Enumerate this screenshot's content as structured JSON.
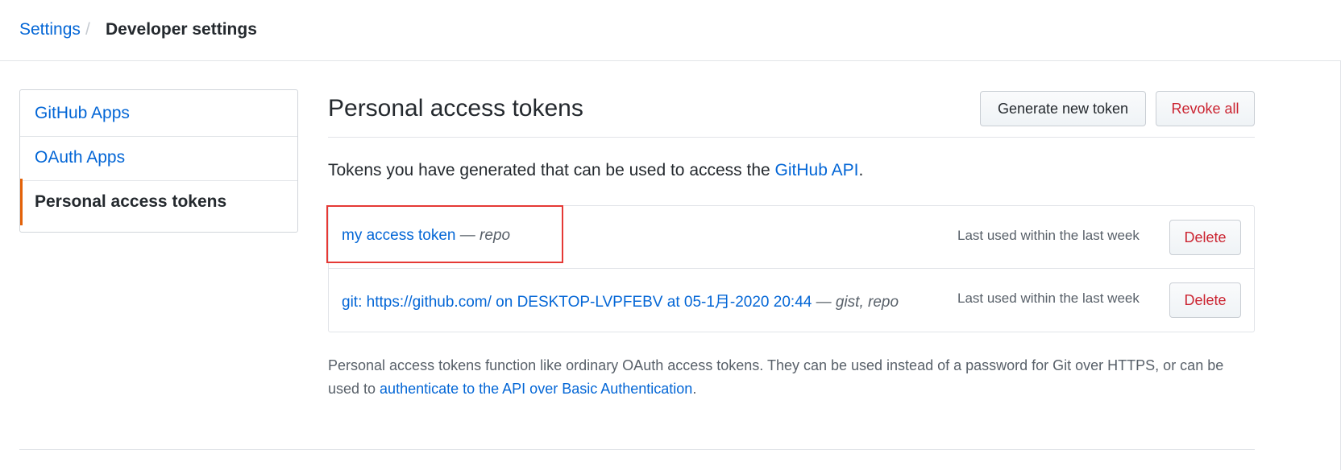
{
  "breadcrumb": {
    "settings": "Settings",
    "separator": "/",
    "current": "Developer settings"
  },
  "sidebar": {
    "items": [
      {
        "label": "GitHub Apps"
      },
      {
        "label": "OAuth Apps"
      },
      {
        "label": "Personal access tokens"
      }
    ]
  },
  "main": {
    "title": "Personal access tokens",
    "generate_label": "Generate new token",
    "revoke_label": "Revoke all",
    "intro_text": "Tokens you have generated that can be used to access the ",
    "intro_link": "GitHub API",
    "intro_end": "."
  },
  "tokens": [
    {
      "name": "my access token",
      "scopes": " — repo",
      "last_used": "Last used within the last week",
      "delete_label": "Delete"
    },
    {
      "name": "git: https://github.com/ on DESKTOP-LVPFEBV at 05-1月-2020 20:44",
      "scopes": " — gist, repo",
      "last_used": "Last used within the last week",
      "delete_label": "Delete"
    }
  ],
  "footnote": {
    "text": "Personal access tokens function like ordinary OAuth access tokens. They can be used instead of a password for Git over HTTPS, or can be used to ",
    "link": "authenticate to the API over Basic Authentication",
    "end": "."
  },
  "colors": {
    "link": "#0366d6",
    "danger": "#cb2431",
    "active_marker": "#e36209",
    "highlight_box": "#e53935"
  }
}
